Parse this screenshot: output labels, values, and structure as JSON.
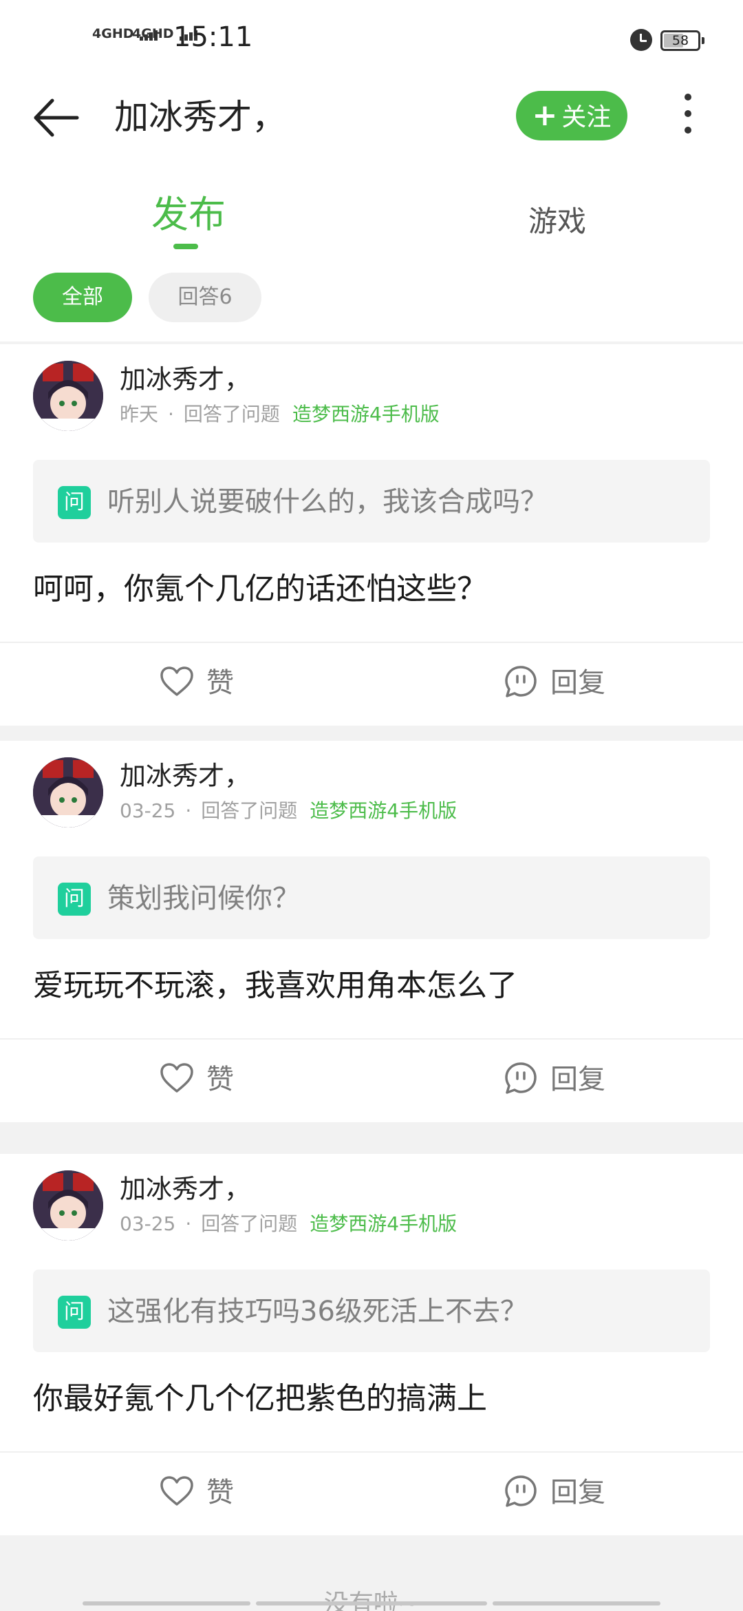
{
  "status_bar": {
    "signal1": "4GHD",
    "signal2": "4GHD",
    "time": "15:11",
    "battery": "58",
    "battery_level": 0.58
  },
  "header": {
    "title": "加冰秀才，",
    "follow_label": "关注"
  },
  "tabs": [
    {
      "label": "发布",
      "active": true
    },
    {
      "label": "游戏",
      "active": false
    }
  ],
  "filters": [
    {
      "label": "全部",
      "active": true
    },
    {
      "label": "回答6",
      "active": false
    }
  ],
  "posts": [
    {
      "author": "加冰秀才，",
      "date": "昨天",
      "action": "回答了问题",
      "game": "造梦西游4手机版",
      "question_badge": "问",
      "question": "听别人说要破什么的，我该合成吗？",
      "answer": "呵呵，你氪个几亿的话还怕这些？",
      "like_label": "赞",
      "reply_label": "回复"
    },
    {
      "author": "加冰秀才，",
      "date": "03-25",
      "action": "回答了问题",
      "game": "造梦西游4手机版",
      "question_badge": "问",
      "question": "策划我问候你？",
      "answer": "爱玩玩不玩滚，我喜欢用角本怎么了",
      "like_label": "赞",
      "reply_label": "回复"
    },
    {
      "author": "加冰秀才，",
      "date": "03-25",
      "action": "回答了问题",
      "game": "造梦西游4手机版",
      "question_badge": "问",
      "question": "这强化有技巧吗36级死活上不去？",
      "answer": "你最好氪个几个亿把紫色的搞满上",
      "like_label": "赞",
      "reply_label": "回复"
    }
  ],
  "footer": {
    "end_text": "没有啦~"
  },
  "colors": {
    "accent": "#4cbc4a",
    "question_badge": "#1fcf9c"
  }
}
